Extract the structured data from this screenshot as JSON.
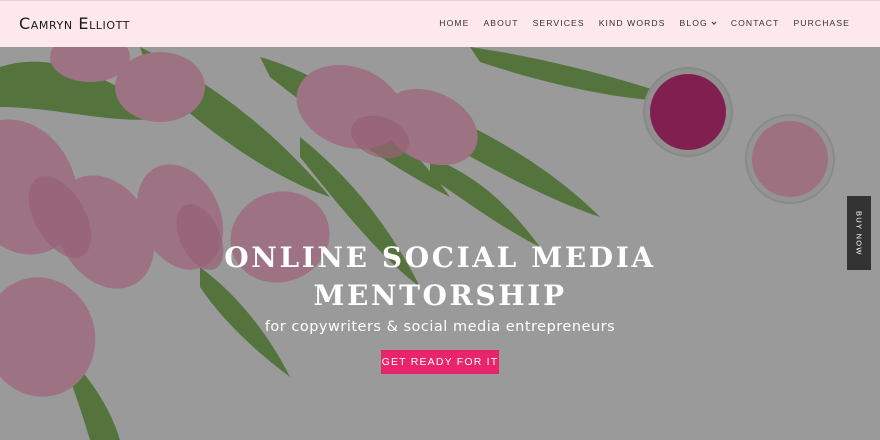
{
  "brand": {
    "name": "Camryn Elliott"
  },
  "nav": {
    "items": [
      {
        "label": "Home"
      },
      {
        "label": "About"
      },
      {
        "label": "Services"
      },
      {
        "label": "Kind Words"
      },
      {
        "label": "Blog"
      },
      {
        "label": "Contact"
      },
      {
        "label": "Purchase"
      }
    ]
  },
  "hero": {
    "title_line1": "Online Social Media",
    "title_line2": "Mentorship",
    "subtitle": "for copywriters & social media entrepreneurs",
    "cta_label": "Get ready for it"
  },
  "side_tab": {
    "label": "Buy Now"
  },
  "colors": {
    "header_bg": "#fde9ec",
    "cta": "#e8246a",
    "side_tab": "#333333"
  }
}
